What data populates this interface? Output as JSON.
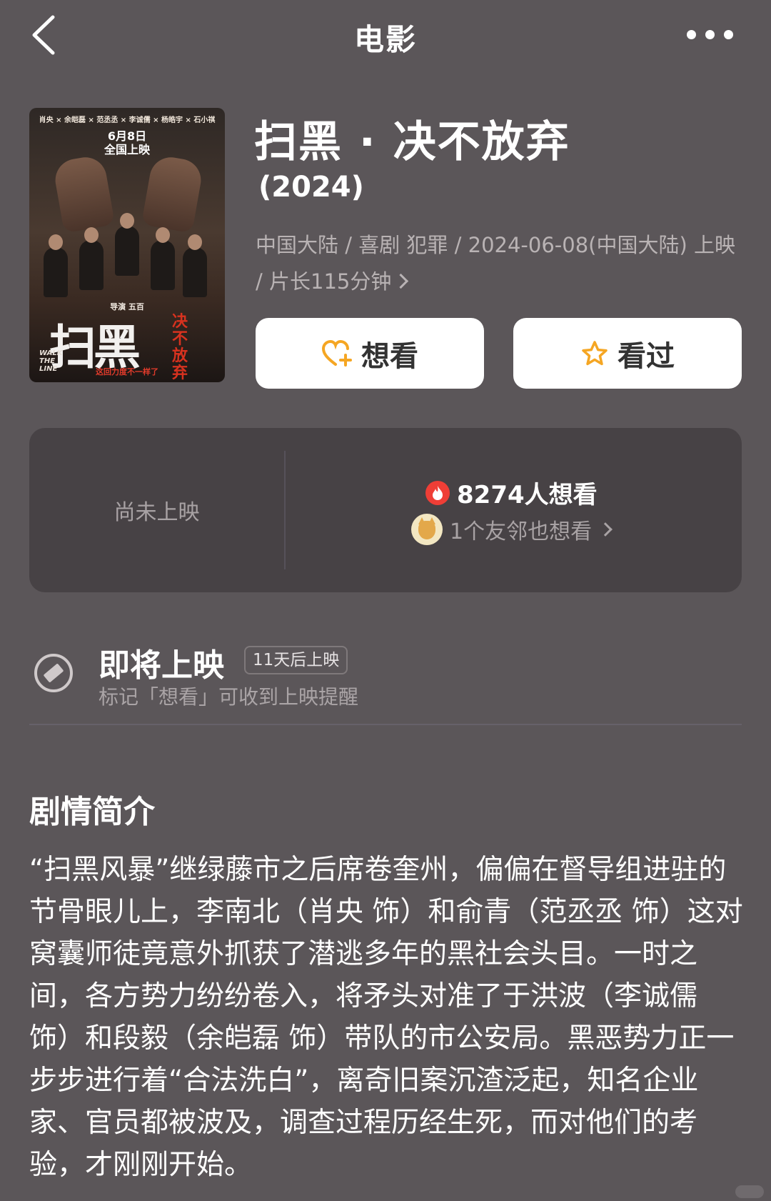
{
  "nav": {
    "title": "电影",
    "back_icon": "chevron-left-icon",
    "more_icon": "more-dots-icon"
  },
  "poster": {
    "cast": "肖央 × 余皑磊 × 范丞丞 × 李诚儒 × 杨皓宇 × 石小祺",
    "release": "6月8日",
    "release_sub": "全国上映",
    "director": "导演 五百",
    "big_title": "扫黑",
    "sub_title": "决不放弃",
    "english": "WALK THE LINE",
    "tagline": "这回力度不一样了"
  },
  "movie": {
    "title": "扫黑 · 决不放弃",
    "year": "(2024)",
    "meta": "中国大陆 / 喜剧 犯罪 / 2024-06-08(中国大陆) 上映 / 片长115分钟"
  },
  "buttons": {
    "want": {
      "label": "想看",
      "icon": "heart-plus-icon",
      "icon_color": "#f5a623"
    },
    "seen": {
      "label": "看过",
      "icon": "star-icon",
      "icon_color": "#f5a623"
    }
  },
  "stats": {
    "status": "尚未上映",
    "want_count": "8274人想看",
    "friends": "1个友邻也想看"
  },
  "upcoming": {
    "title": "即将上映",
    "badge": "11天后上映",
    "reminder": "标记「想看」可收到上映提醒"
  },
  "synopsis": {
    "heading": "剧情简介",
    "text": "“扫黑风暴”继绿藤市之后席卷奎州，偏偏在督导组进驻的节骨眼儿上，李南北（肖央 饰）和俞青（范丞丞 饰）这对窝囊师徒竟意外抓获了潜逃多年的黑社会头目。一时之间，各方势力纷纷卷入，将矛头对准了于洪波（李诚儒 饰）和段毅（余皑磊 饰）带队的市公安局。黑恶势力正一步步进行着“合法洗白”，离奇旧案沉渣泛起，知名企业家、官员都被波及，调查过程历经生死，而对他们的考验，才刚刚开始。"
  },
  "colors": {
    "background": "#5b5659",
    "card": "#474245",
    "accent": "#f5a623",
    "fire": "#ef3e36"
  }
}
